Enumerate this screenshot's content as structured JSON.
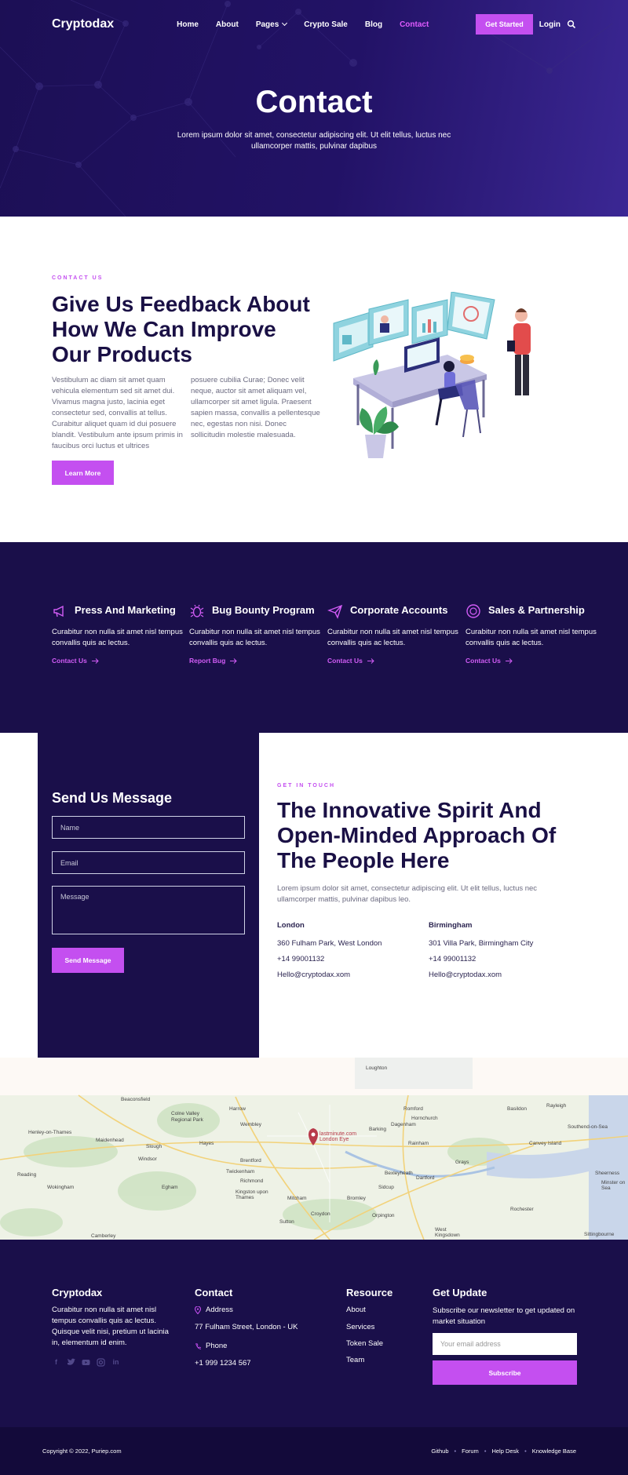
{
  "nav": {
    "logo": "Cryptodax",
    "items": [
      "Home",
      "About",
      "Pages",
      "Crypto Sale",
      "Blog",
      "Contact"
    ],
    "cta": "Get Started",
    "login": "Login"
  },
  "hero": {
    "title": "Contact",
    "subtitle_line1": "Lorem ipsum dolor sit amet, consectetur adipiscing elit. Ut elit tellus, luctus nec",
    "subtitle_line2": "ullamcorper mattis, pulvinar dapibus"
  },
  "feedback": {
    "eyebrow": "CONTACT US",
    "title": "Give Us Feedback About How We Can Improve Our Products",
    "col1": "Vestibulum ac diam sit amet quam vehicula elementum sed sit amet dui. Vivamus magna justo, lacinia eget consectetur sed, convallis at tellus. Curabitur aliquet quam id dui posuere blandit. Vestibulum ante ipsum primis in faucibus orci luctus et ultrices",
    "col2": "posuere cubilia Curae; Donec velit neque, auctor sit amet aliquam vel, ullamcorper sit amet ligula. Praesent sapien massa, convallis a pellentesque nec, egestas non nisi. Donec sollicitudin molestie malesuada.",
    "button": "Learn More"
  },
  "services": [
    {
      "title": "Press And Marketing",
      "text": "Curabitur non nulla sit amet nisl tempus convallis quis ac lectus.",
      "link": "Contact Us",
      "icon": "megaphone-icon"
    },
    {
      "title": "Bug Bounty Program",
      "text": "Curabitur non nulla sit amet nisl tempus convallis quis ac lectus.",
      "link": "Report Bug",
      "icon": "bug-icon"
    },
    {
      "title": "Corporate Accounts",
      "text": "Curabitur non nulla sit amet nisl tempus convallis quis ac lectus.",
      "link": "Contact Us",
      "icon": "paper-plane-icon"
    },
    {
      "title": "Sales & Partnership",
      "text": "Curabitur non nulla sit amet nisl tempus convallis quis ac lectus.",
      "link": "Contact Us",
      "icon": "badge-icon"
    }
  ],
  "form": {
    "title": "Send Us Message",
    "name_placeholder": "Name",
    "email_placeholder": "Email",
    "message_placeholder": "Message",
    "button": "Send Message"
  },
  "get_in_touch": {
    "eyebrow": "GET IN TOUCH",
    "title": "The Innovative Spirit And Open-Minded Approach Of The People Here",
    "text": "Lorem ipsum dolor sit amet, consectetur adipiscing elit. Ut elit tellus, luctus nec ullamcorper mattis, pulvinar dapibus leo.",
    "offices": [
      {
        "city": "London",
        "address": "360 Fulham Park, West London",
        "phone": "+14 99001132",
        "email": "Hello@cryptodax.xom"
      },
      {
        "city": "Birmingham",
        "address": "301 Villa Park, Birmingham City",
        "phone": "+14 99001132",
        "email": "Hello@cryptodax.xom"
      }
    ]
  },
  "map": {
    "labels": [
      "Loughton",
      "Beaconsfield",
      "Colne Valley Regional Park",
      "Harrow",
      "Romford",
      "Basildon",
      "Rayleigh",
      "Southend-on-Sea",
      "Henley-on-Thames",
      "Maidenhead",
      "Slough",
      "Hayes",
      "Wembley",
      "Barking",
      "Dagenham",
      "Hornchurch",
      "Canvey Island",
      "lastminute.com London Eye",
      "Windsor",
      "Brentford",
      "Rainham",
      "Grays",
      "Reading",
      "Wokingham",
      "Egham",
      "Twickenham",
      "Richmond",
      "Kingston upon Thames",
      "Bexleyheath",
      "Dartford",
      "Sidcup",
      "Bromley",
      "Mitcham",
      "Croydon",
      "Orpington",
      "Camberley",
      "Sutton",
      "West Kingsdown",
      "Sittingbourne",
      "Sheerness",
      "Minster on Sea",
      "Rochester"
    ]
  },
  "footer": {
    "brand": "Cryptodax",
    "brand_text": "Curabitur non nulla sit amet nisl tempus convallis quis ac lectus. Quisque velit nisi, pretium ut lacinia in, elementum id enim.",
    "socials": [
      "facebook-icon",
      "twitter-icon",
      "youtube-icon",
      "instagram-icon",
      "linkedin-icon"
    ],
    "contact_title": "Contact",
    "address_label": "Address",
    "address": "77 Fulham Street, London - UK",
    "phone_label": "Phone",
    "phone": "+1 999 1234 567",
    "resource_title": "Resource",
    "resources": [
      "About",
      "Services",
      "Token Sale",
      "Team"
    ],
    "update_title": "Get Update",
    "update_text": "Subscribe our newsletter to get updated on market situation",
    "email_placeholder": "Your email address",
    "subscribe": "Subscribe"
  },
  "bottom": {
    "copyright": "Copyright © 2022, Puriep.com",
    "links": [
      "Github",
      "Forum",
      "Help Desk",
      "Knowledge Base"
    ]
  },
  "colors": {
    "accent": "#c44ff0",
    "navy": "#1a0f4a",
    "hero": "#1c0f55"
  }
}
